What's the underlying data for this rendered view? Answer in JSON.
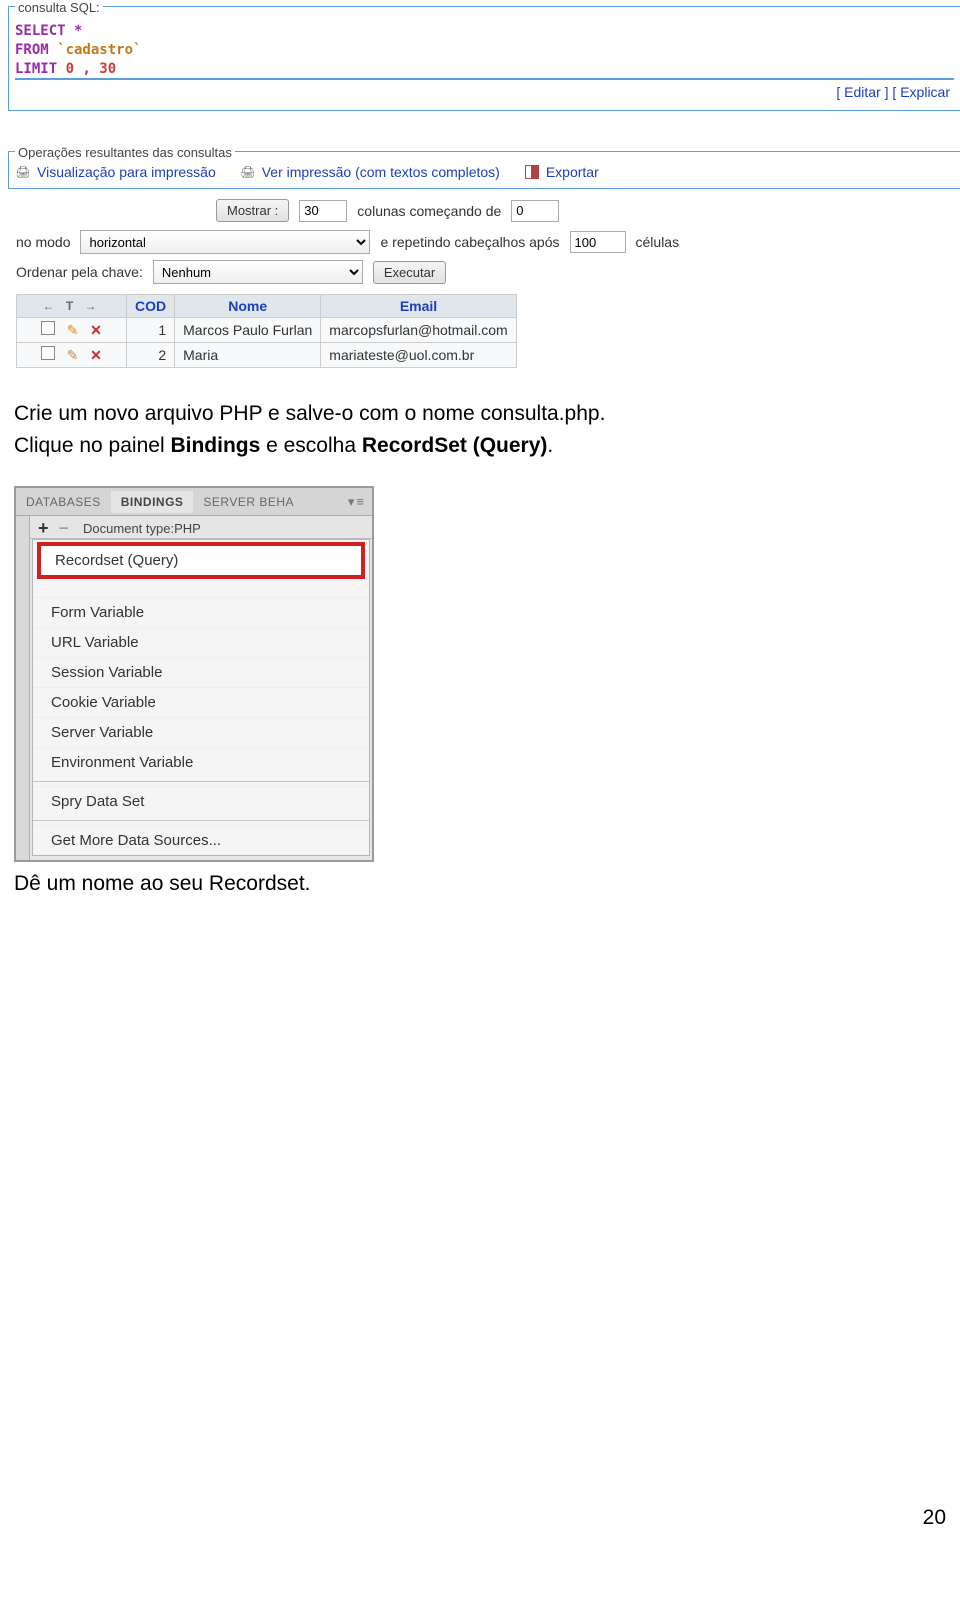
{
  "sql": {
    "legend": "consulta SQL:",
    "line1_kw": "SELECT",
    "line1_star": " *",
    "line2_kw": "FROM",
    "line2_tbl": " `cadastro`",
    "line3_kw": "LIMIT",
    "line3_num1": " 0",
    "line3_comma": " ,",
    "line3_num2": " 30",
    "link_edit_open": "[ ",
    "link_edit": "Editar",
    "link_edit_close": " ]",
    "link_explain_open": " [ ",
    "link_explain": "Explicar",
    "link_explain_close": ""
  },
  "ops": {
    "legend": "Operações resultantes das consultas",
    "print_view": "Visualização para impressão",
    "print_full": "Ver impressão (com textos completos)",
    "export": "Exportar"
  },
  "ctrl": {
    "mostrar_btn": "Mostrar :",
    "mostrar_val": "30",
    "colunas_txt": "colunas começando de",
    "start_val": "0",
    "nomodo": "no modo",
    "modo_val": "horizontal",
    "repetindo": "e repetindo cabeçalhos após",
    "headers_val": "100",
    "celulas": "células",
    "ordenar": "Ordenar pela chave:",
    "ordenar_val": "Nenhum",
    "executar": "Executar"
  },
  "table": {
    "headers": {
      "cod": "COD",
      "nome": "Nome",
      "email": "Email"
    },
    "rows": [
      {
        "cod": "1",
        "nome": "Marcos Paulo Furlan",
        "email": "marcopsfurlan@hotmail.com"
      },
      {
        "cod": "2",
        "nome": "Maria",
        "email": "mariateste@uol.com.br"
      }
    ]
  },
  "para1": {
    "t1": "Crie um novo arquivo PHP e salve-o com o nome consulta.php.",
    "t2a": "Clique no painel ",
    "t2b": "Bindings",
    "t2c": " e escolha ",
    "t2d": "RecordSet (Query)",
    "t2e": "."
  },
  "dw": {
    "tabs": {
      "databases": "DATABASES",
      "bindings": "BINDINGS",
      "server": "SERVER BEHA"
    },
    "controls_glyph": "▾≡",
    "plus": "+",
    "minus": "−",
    "doctype": "Document type:PHP",
    "items": {
      "recordset": "Recordset (Query)",
      "form": "Form Variable",
      "url": "URL Variable",
      "session": "Session Variable",
      "cookie": "Cookie Variable",
      "server": "Server Variable",
      "env": "Environment Variable",
      "spry": "Spry Data Set",
      "more": "Get More Data Sources..."
    }
  },
  "para2": "Dê um nome ao seu Recordset.",
  "page_num": "20"
}
